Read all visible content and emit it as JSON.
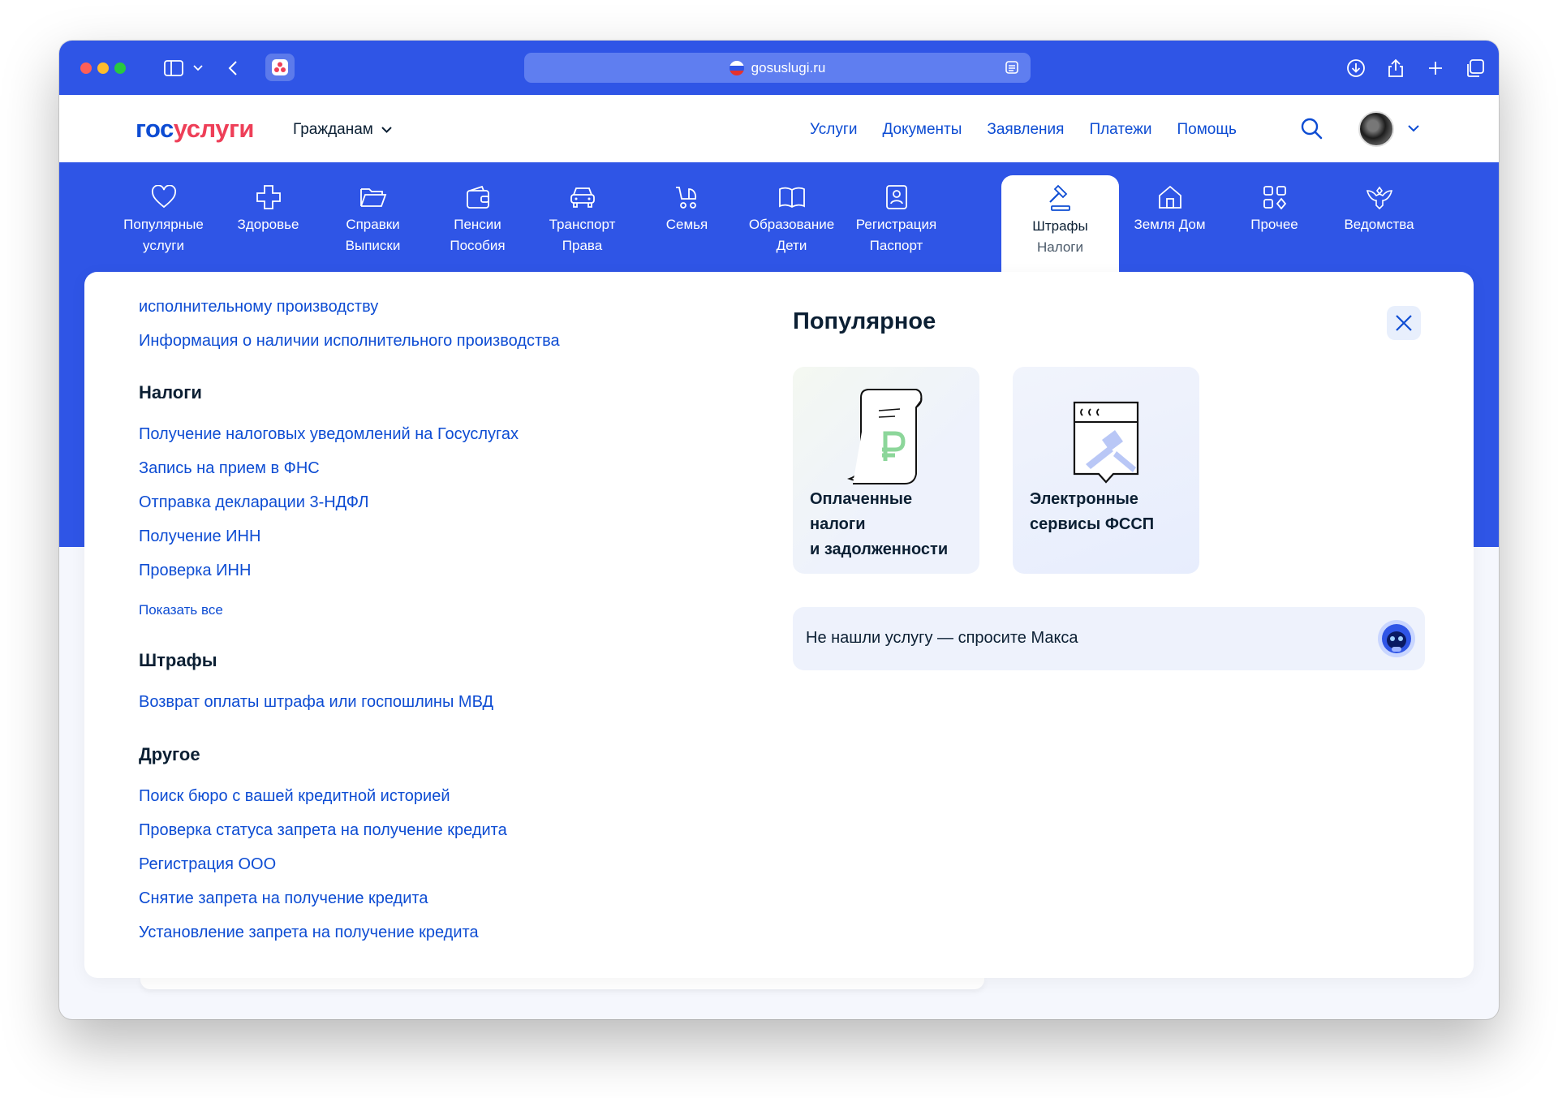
{
  "browser": {
    "url": "gosuslugi.ru"
  },
  "header": {
    "logo_part1": "гос",
    "logo_part2": "услуги",
    "audience": "Гражданам",
    "nav": [
      "Услуги",
      "Документы",
      "Заявления",
      "Платежи",
      "Помощь"
    ]
  },
  "categories": [
    {
      "line1": "Популярные",
      "line2": "услуги",
      "icon": "heart-icon"
    },
    {
      "line1": "Здоровье",
      "line2": "",
      "icon": "medical-cross-icon"
    },
    {
      "line1": "Справки",
      "line2": "Выписки",
      "icon": "folder-icon"
    },
    {
      "line1": "Пенсии",
      "line2": "Пособия",
      "icon": "wallet-icon"
    },
    {
      "line1": "Транспорт",
      "line2": "Права",
      "icon": "car-icon"
    },
    {
      "line1": "Семья",
      "line2": "",
      "icon": "stroller-icon"
    },
    {
      "line1": "Образование",
      "line2": "Дети",
      "icon": "book-icon"
    },
    {
      "line1": "Регистрация",
      "line2": "Паспорт",
      "icon": "id-card-icon"
    },
    {
      "line1": "Штрафы",
      "line2": "Налоги",
      "icon": "gavel-icon",
      "active": true
    },
    {
      "line1": "Земля Дом",
      "line2": "",
      "icon": "house-icon"
    },
    {
      "line1": "Прочее",
      "line2": "",
      "icon": "grid-icon"
    },
    {
      "line1": "Ведомства",
      "line2": "",
      "icon": "emblem-icon"
    }
  ],
  "panel": {
    "top_links": [
      "исполнительному производству",
      "Информация о наличии исполнительного производства"
    ],
    "taxes": {
      "title": "Налоги",
      "links": [
        "Получение налоговых уведомлений на Госуслугах",
        "Запись на прием в ФНС",
        "Отправка декларации 3-НДФЛ",
        "Получение ИНН",
        "Проверка ИНН"
      ],
      "show_all": "Показать все"
    },
    "fines": {
      "title": "Штрафы",
      "links": [
        "Возврат оплаты штрафа или госпошлины МВД"
      ]
    },
    "other": {
      "title": "Другое",
      "links": [
        "Поиск бюро с вашей кредитной историей",
        "Проверка статуса запрета на получение кредита",
        "Регистрация ООО",
        "Снятие запрета на получение кредита",
        "Установление запрета на получение кредита"
      ]
    },
    "popular": {
      "title": "Популярное",
      "cards": [
        {
          "line1": "Оплаченные",
          "line2": "налоги",
          "line3": "и задолженности",
          "icon": "receipt-ruble-icon"
        },
        {
          "line1": "Электронные",
          "line2": "сервисы ФССП",
          "line3": "",
          "icon": "fssp-gavel-icon"
        }
      ],
      "max_prompt": "Не нашли услугу — спросите Макса"
    }
  },
  "colors": {
    "brand_blue": "#2f55e6",
    "link_blue": "#0d4cd3",
    "logo_red": "#ee3f58",
    "text_dark": "#0b1f33"
  }
}
